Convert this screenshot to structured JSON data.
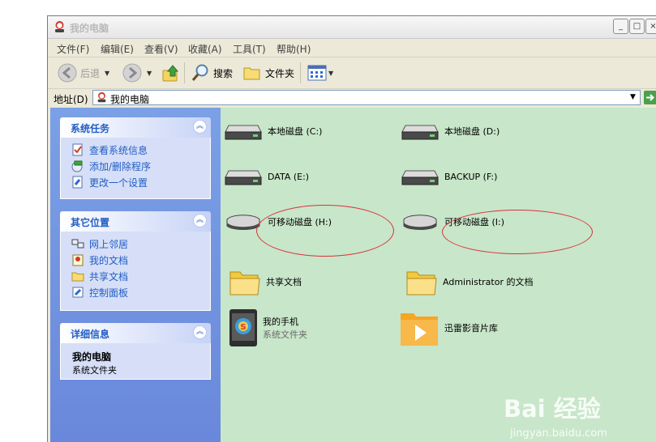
{
  "window": {
    "title": "我的电脑"
  },
  "title_buttons": {
    "minimize": "_",
    "restore": "□",
    "close": "×"
  },
  "menu": [
    {
      "label": "文件(F)"
    },
    {
      "label": "编辑(E)"
    },
    {
      "label": "查看(V)"
    },
    {
      "label": "收藏(A)"
    },
    {
      "label": "工具(T)"
    },
    {
      "label": "帮助(H)"
    }
  ],
  "toolbar": {
    "back": "后退",
    "search": "搜索",
    "folders": "文件夹"
  },
  "address": {
    "label": "地址(D)",
    "value": "我的电脑"
  },
  "panels": {
    "system_tasks": {
      "title": "系统任务",
      "links": [
        "查看系统信息",
        "添加/删除程序",
        "更改一个设置"
      ]
    },
    "other_places": {
      "title": "其它位置",
      "links": [
        "网上邻居",
        "我的文档",
        "共享文档",
        "控制面板"
      ]
    },
    "details": {
      "title": "详细信息",
      "name": "我的电脑",
      "type": "系统文件夹"
    }
  },
  "items": [
    {
      "label": "本地磁盘 (C:)"
    },
    {
      "label": "本地磁盘 (D:)"
    },
    {
      "label": "DATA (E:)"
    },
    {
      "label": "BACKUP (F:)"
    },
    {
      "label": "可移动磁盘 (H:)"
    },
    {
      "label": "可移动磁盘 (I:)"
    },
    {
      "label": "共享文档"
    },
    {
      "label": "Administrator 的文档"
    },
    {
      "label": "我的手机",
      "sub": "系统文件夹"
    },
    {
      "label": "迅雷影音片库"
    }
  ],
  "watermark": {
    "brand": "Bai  经验",
    "url": "jingyan.baidu.com"
  },
  "colors": {
    "pane_bg": "#c8e6c9",
    "task_link": "#215dc6",
    "highlight": "#d9313b"
  }
}
